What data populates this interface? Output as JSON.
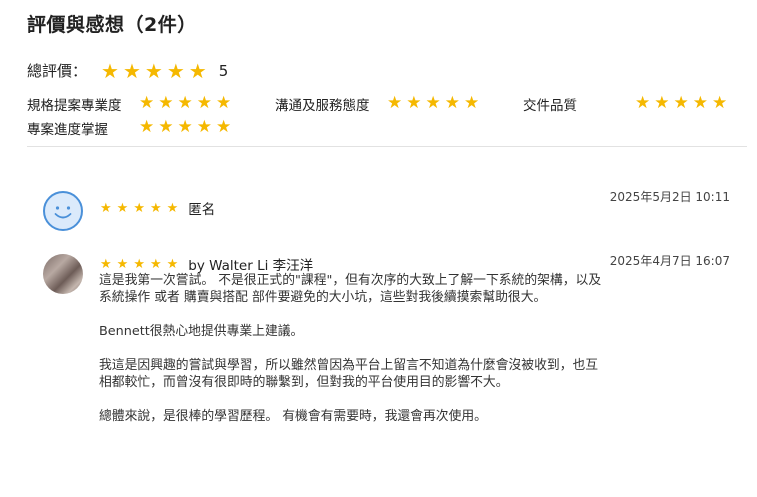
{
  "page": {
    "title": "評價與感想（2件）"
  },
  "overall": {
    "label": "總評價：",
    "score": "5",
    "stars": 5
  },
  "criteria": [
    {
      "label": "規格提案專業度",
      "stars": 5
    },
    {
      "label": "溝通及服務態度",
      "stars": 5
    },
    {
      "label": "交件品質",
      "stars": 5
    },
    {
      "label": "專案進度掌握",
      "stars": 5
    }
  ],
  "icons": {
    "star": "star-icon",
    "smile": "smiley-face-icon"
  },
  "colors": {
    "star": "#f5b800",
    "avatar_border": "#4a90d9"
  },
  "reviews": [
    {
      "stars": 5,
      "name": "匿名",
      "date": "2025年5月2日 10:11",
      "paragraphs": []
    },
    {
      "stars": 5,
      "name": "by Walter Li 李汪洋",
      "date": "2025年4月7日 16:07",
      "paragraphs": [
        "這是我第一次嘗試。 不是很正式的\"課程\"，但有次序的大致上了解一下系統的架構，以及系統操作 或者 購賣與搭配 部件要避免的大小坑，這些對我後續摸索幫助很大。",
        "Bennett很熱心地提供專業上建議。",
        "我這是因興趣的嘗試與學習，所以雖然曾因為平台上留言不知道為什麼會沒被收到，也互相都較忙，而曾沒有很即時的聯繫到，但對我的平台使用目的影響不大。",
        "總體來說，是很棒的學習歷程。 有機會有需要時，我還會再次使用。"
      ]
    }
  ]
}
